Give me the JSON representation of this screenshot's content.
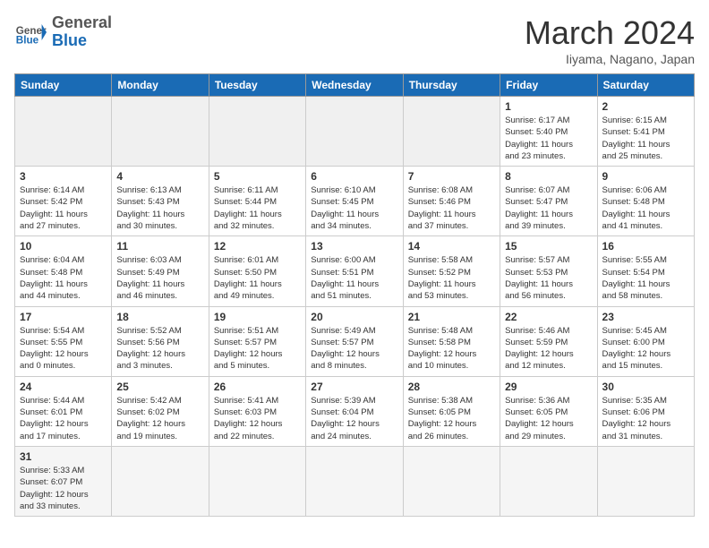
{
  "header": {
    "logo_general": "General",
    "logo_blue": "Blue",
    "month_title": "March 2024",
    "location": "Iiyama, Nagano, Japan"
  },
  "weekdays": [
    "Sunday",
    "Monday",
    "Tuesday",
    "Wednesday",
    "Thursday",
    "Friday",
    "Saturday"
  ],
  "weeks": [
    [
      {
        "day": "",
        "info": ""
      },
      {
        "day": "",
        "info": ""
      },
      {
        "day": "",
        "info": ""
      },
      {
        "day": "",
        "info": ""
      },
      {
        "day": "",
        "info": ""
      },
      {
        "day": "1",
        "info": "Sunrise: 6:17 AM\nSunset: 5:40 PM\nDaylight: 11 hours\nand 23 minutes."
      },
      {
        "day": "2",
        "info": "Sunrise: 6:15 AM\nSunset: 5:41 PM\nDaylight: 11 hours\nand 25 minutes."
      }
    ],
    [
      {
        "day": "3",
        "info": "Sunrise: 6:14 AM\nSunset: 5:42 PM\nDaylight: 11 hours\nand 27 minutes."
      },
      {
        "day": "4",
        "info": "Sunrise: 6:13 AM\nSunset: 5:43 PM\nDaylight: 11 hours\nand 30 minutes."
      },
      {
        "day": "5",
        "info": "Sunrise: 6:11 AM\nSunset: 5:44 PM\nDaylight: 11 hours\nand 32 minutes."
      },
      {
        "day": "6",
        "info": "Sunrise: 6:10 AM\nSunset: 5:45 PM\nDaylight: 11 hours\nand 34 minutes."
      },
      {
        "day": "7",
        "info": "Sunrise: 6:08 AM\nSunset: 5:46 PM\nDaylight: 11 hours\nand 37 minutes."
      },
      {
        "day": "8",
        "info": "Sunrise: 6:07 AM\nSunset: 5:47 PM\nDaylight: 11 hours\nand 39 minutes."
      },
      {
        "day": "9",
        "info": "Sunrise: 6:06 AM\nSunset: 5:48 PM\nDaylight: 11 hours\nand 41 minutes."
      }
    ],
    [
      {
        "day": "10",
        "info": "Sunrise: 6:04 AM\nSunset: 5:48 PM\nDaylight: 11 hours\nand 44 minutes."
      },
      {
        "day": "11",
        "info": "Sunrise: 6:03 AM\nSunset: 5:49 PM\nDaylight: 11 hours\nand 46 minutes."
      },
      {
        "day": "12",
        "info": "Sunrise: 6:01 AM\nSunset: 5:50 PM\nDaylight: 11 hours\nand 49 minutes."
      },
      {
        "day": "13",
        "info": "Sunrise: 6:00 AM\nSunset: 5:51 PM\nDaylight: 11 hours\nand 51 minutes."
      },
      {
        "day": "14",
        "info": "Sunrise: 5:58 AM\nSunset: 5:52 PM\nDaylight: 11 hours\nand 53 minutes."
      },
      {
        "day": "15",
        "info": "Sunrise: 5:57 AM\nSunset: 5:53 PM\nDaylight: 11 hours\nand 56 minutes."
      },
      {
        "day": "16",
        "info": "Sunrise: 5:55 AM\nSunset: 5:54 PM\nDaylight: 11 hours\nand 58 minutes."
      }
    ],
    [
      {
        "day": "17",
        "info": "Sunrise: 5:54 AM\nSunset: 5:55 PM\nDaylight: 12 hours\nand 0 minutes."
      },
      {
        "day": "18",
        "info": "Sunrise: 5:52 AM\nSunset: 5:56 PM\nDaylight: 12 hours\nand 3 minutes."
      },
      {
        "day": "19",
        "info": "Sunrise: 5:51 AM\nSunset: 5:57 PM\nDaylight: 12 hours\nand 5 minutes."
      },
      {
        "day": "20",
        "info": "Sunrise: 5:49 AM\nSunset: 5:57 PM\nDaylight: 12 hours\nand 8 minutes."
      },
      {
        "day": "21",
        "info": "Sunrise: 5:48 AM\nSunset: 5:58 PM\nDaylight: 12 hours\nand 10 minutes."
      },
      {
        "day": "22",
        "info": "Sunrise: 5:46 AM\nSunset: 5:59 PM\nDaylight: 12 hours\nand 12 minutes."
      },
      {
        "day": "23",
        "info": "Sunrise: 5:45 AM\nSunset: 6:00 PM\nDaylight: 12 hours\nand 15 minutes."
      }
    ],
    [
      {
        "day": "24",
        "info": "Sunrise: 5:44 AM\nSunset: 6:01 PM\nDaylight: 12 hours\nand 17 minutes."
      },
      {
        "day": "25",
        "info": "Sunrise: 5:42 AM\nSunset: 6:02 PM\nDaylight: 12 hours\nand 19 minutes."
      },
      {
        "day": "26",
        "info": "Sunrise: 5:41 AM\nSunset: 6:03 PM\nDaylight: 12 hours\nand 22 minutes."
      },
      {
        "day": "27",
        "info": "Sunrise: 5:39 AM\nSunset: 6:04 PM\nDaylight: 12 hours\nand 24 minutes."
      },
      {
        "day": "28",
        "info": "Sunrise: 5:38 AM\nSunset: 6:05 PM\nDaylight: 12 hours\nand 26 minutes."
      },
      {
        "day": "29",
        "info": "Sunrise: 5:36 AM\nSunset: 6:05 PM\nDaylight: 12 hours\nand 29 minutes."
      },
      {
        "day": "30",
        "info": "Sunrise: 5:35 AM\nSunset: 6:06 PM\nDaylight: 12 hours\nand 31 minutes."
      }
    ],
    [
      {
        "day": "31",
        "info": "Sunrise: 5:33 AM\nSunset: 6:07 PM\nDaylight: 12 hours\nand 33 minutes."
      },
      {
        "day": "",
        "info": ""
      },
      {
        "day": "",
        "info": ""
      },
      {
        "day": "",
        "info": ""
      },
      {
        "day": "",
        "info": ""
      },
      {
        "day": "",
        "info": ""
      },
      {
        "day": "",
        "info": ""
      }
    ]
  ]
}
